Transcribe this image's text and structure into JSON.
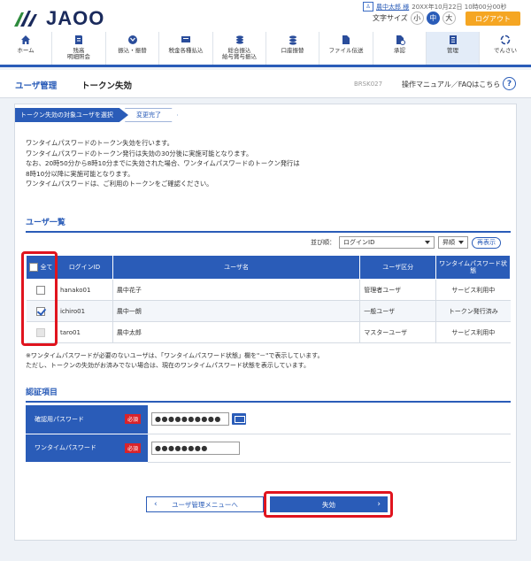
{
  "header": {
    "logo_text": "JAOO",
    "user_name": "農中太郎 様",
    "datetime": "20XX年10月22日 10時00分00秒",
    "fontsize_label": "文字サイズ",
    "fontsize_options": [
      "小",
      "中",
      "大"
    ],
    "fontsize_selected": "中",
    "logout_label": "ログアウト",
    "colors": {
      "primary": "#2a5cb8",
      "logout": "#f5a623",
      "highlight": "#e0141e"
    }
  },
  "nav": {
    "items": [
      {
        "label": "ホーム",
        "icon": "home-icon"
      },
      {
        "label": "残高\n明細照会",
        "icon": "account-book-icon"
      },
      {
        "label": "振込・振替",
        "icon": "transfer-icon"
      },
      {
        "label": "税金各種払込",
        "icon": "tax-payment-icon"
      },
      {
        "label": "総合振込\n給与賞与振込",
        "icon": "bulk-transfer-icon"
      },
      {
        "label": "口座振替",
        "icon": "direct-debit-icon"
      },
      {
        "label": "ファイル伝送",
        "icon": "file-transfer-icon"
      },
      {
        "label": "承認",
        "icon": "approval-icon"
      },
      {
        "label": "管理",
        "icon": "admin-icon"
      },
      {
        "label": "でんさい",
        "icon": "densai-icon"
      }
    ],
    "active_index": 8
  },
  "titlebar": {
    "section": "ユーザ管理",
    "title": "トークン失効",
    "screen_id": "BRSK027",
    "manual_link": "操作マニュアル／FAQはこちら",
    "help_icon": "question-icon"
  },
  "steps": [
    "トークン失効の対象ユーザを選択",
    "変更完了"
  ],
  "notice_lines": [
    "ワンタイムパスワードのトークン失効を行います。",
    "ワンタイムパスワードのトークン発行は失効の30分後に実施可能となります。",
    "なお、20時50分から8時10分までに失効された場合、ワンタイムパスワードのトークン発行は",
    "8時10分以降に実施可能となります。",
    "ワンタイムパスワードは、ご利用のトークンをご確認ください。"
  ],
  "user_list": {
    "heading": "ユーザ一覧",
    "sort_label": "並び順：",
    "sort_field": "ログインID",
    "sort_order": "昇順",
    "resort_button": "再表示",
    "columns": [
      "全て",
      "ログインID",
      "ユーザ名",
      "ユーザ区分",
      "ワンタイムパスワード状態"
    ],
    "rows": [
      {
        "login_id": "hanako01",
        "user_name": "農中花子",
        "user_type": "管理者ユーザ",
        "otp_status": "サービス利用中",
        "checked": false,
        "disabled": false
      },
      {
        "login_id": "ichiro01",
        "user_name": "農中一朗",
        "user_type": "一般ユーザ",
        "otp_status": "トークン発行済み",
        "checked": true,
        "disabled": false
      },
      {
        "login_id": "taro01",
        "user_name": "農中太郎",
        "user_type": "マスターユーザ",
        "otp_status": "サービス利用中",
        "checked": false,
        "disabled": true
      }
    ]
  },
  "notes": [
    "※ワンタイムパスワードが必要のないユーザは、「ワンタイムパスワード状態」欄を\"－\"で表示しています。",
    "ただし、トークンの失効がお済みでない場合は、現在のワンタイムパスワード状態を表示しています。"
  ],
  "auth": {
    "heading": "認証項目",
    "required_label": "必須",
    "fields": [
      {
        "label": "確認用パスワード",
        "value": "●●●●●●●●●●",
        "has_keyboard": true
      },
      {
        "label": "ワンタイムパスワード",
        "value": "●●●●●●●●",
        "has_keyboard": false
      }
    ]
  },
  "buttons": {
    "back": "ユーザ管理メニューへ",
    "execute": "失効"
  }
}
